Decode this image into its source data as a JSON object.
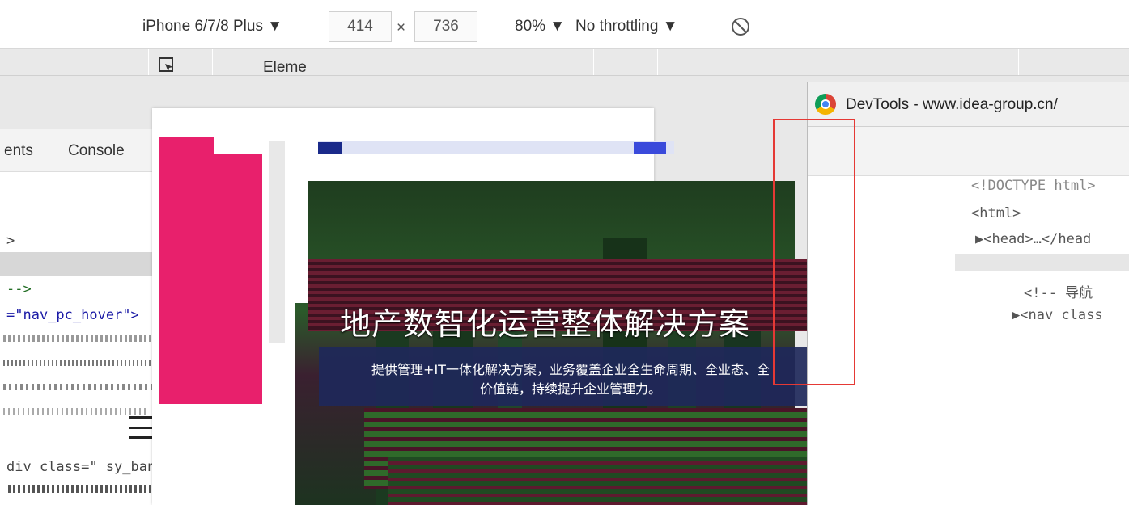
{
  "device_toolbar": {
    "device": "iPhone 6/7/8 Plus ▼",
    "width": "414",
    "times": "×",
    "height": "736",
    "zoom": "80% ▼",
    "throttling": "No throttling ▼",
    "rotate_icon": "rotate-icon"
  },
  "left_panel": {
    "tabs": [
      "ents",
      "Console"
    ],
    "lines": [
      "-->",
      "=\"nav_pc_hover\">",
      "div class=\" sy_banner sy_"
    ],
    "caret": ">"
  },
  "page": {
    "banner_title": "地产数智化运营整体解决方案",
    "banner_desc": "提供管理+IT一体化解决方案，业务覆盖企业全生命周期、全业态、全价值链，持续提升企业管理力。"
  },
  "devtools_window": {
    "title": "DevTools - www.idea-group.cn/",
    "tab": "Eleme",
    "lines": [
      "<!DOCTYPE html>",
      "<html>",
      "▶<head>…</head",
      "<!-- 导航",
      "▶<nav class"
    ]
  },
  "colors": {
    "accent_pink": "#e8206c",
    "highlight_red": "#e53935",
    "banner_desc_bg": "#1e285a"
  }
}
